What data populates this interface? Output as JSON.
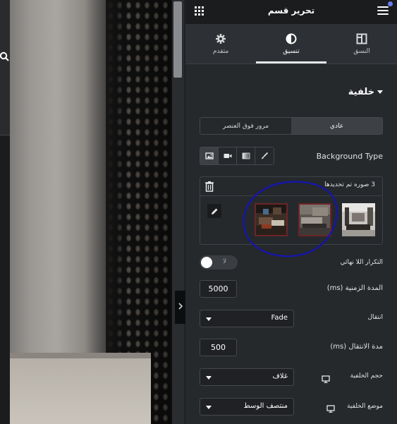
{
  "panel": {
    "title": "تحرير قسم",
    "tabs": [
      {
        "label": "النسق",
        "icon": "layout-icon"
      },
      {
        "label": "تنسيق",
        "icon": "contrast-icon",
        "active": true
      },
      {
        "label": "متقدم",
        "icon": "gear-icon"
      }
    ]
  },
  "section": {
    "title": "خلفية"
  },
  "state_switcher": {
    "normal": "عادي",
    "hover": "مرور فوق العنصر"
  },
  "background_type": {
    "label": "Background Type",
    "options": [
      "classic-brush-icon",
      "gradient-icon",
      "video-icon",
      "slideshow-icon"
    ],
    "selected": "slideshow-icon"
  },
  "gallery": {
    "count_text": "3 صوره تم تحديدها"
  },
  "infinite_loop": {
    "label": "التكرار اللا نهائي",
    "state_text": "لا"
  },
  "duration": {
    "label": "المدة الزمنية (ms)",
    "value": "5000"
  },
  "transition": {
    "label": "انتقال",
    "value": "Fade"
  },
  "transition_duration": {
    "label": "مدة الانتقال (ms)",
    "value": "500"
  },
  "background_size": {
    "label": "حجم الخلفية",
    "value": "غلاف"
  },
  "background_position": {
    "label": "موضع الخلفية",
    "value": "منتصف الوسط"
  },
  "colors": {
    "panel_bg": "#26292c",
    "topbar_bg": "#1b1c1e",
    "annotation": "#1515a8",
    "selection_border": "#6b2528",
    "notify": "#6d7bf6"
  }
}
